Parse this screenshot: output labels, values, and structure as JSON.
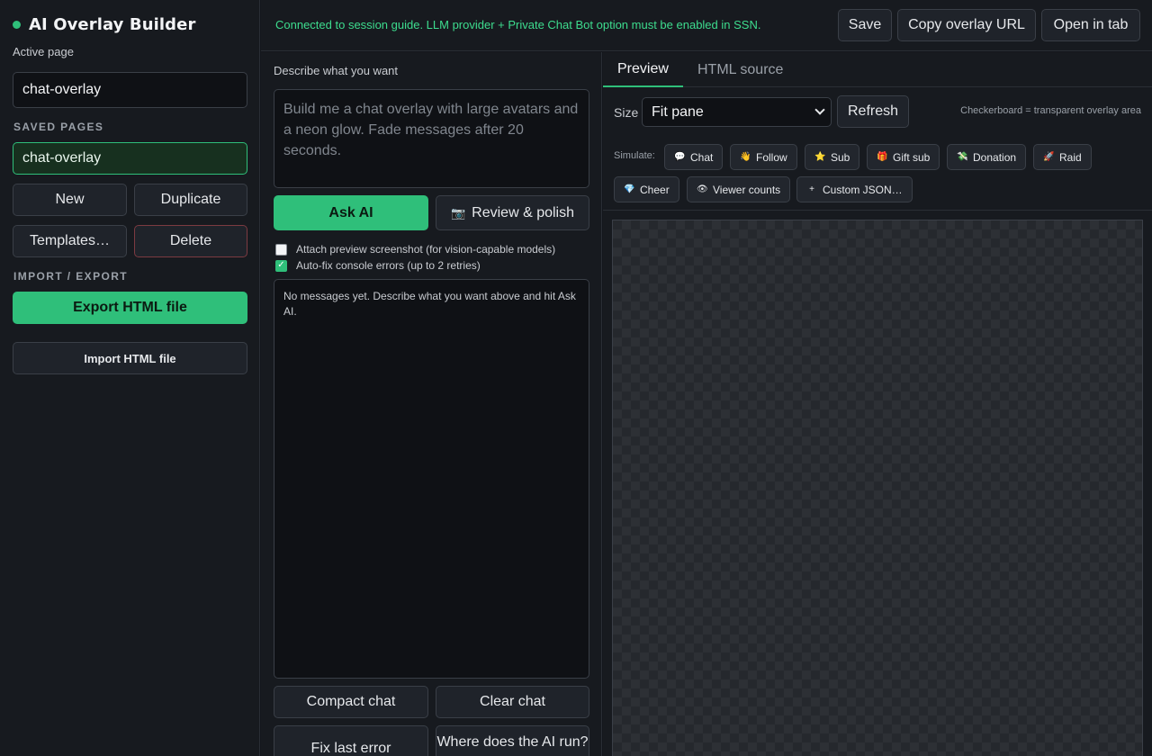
{
  "app": {
    "title": "AI Overlay Builder"
  },
  "sidebar": {
    "active_page_label": "Active page",
    "active_page_value": "chat-overlay",
    "saved_pages_label": "SAVED PAGES",
    "saved_pages": [
      "chat-overlay"
    ],
    "new_label": "New",
    "duplicate_label": "Duplicate",
    "templates_label": "Templates…",
    "delete_label": "Delete",
    "import_export_label": "IMPORT / EXPORT",
    "export_label": "Export HTML file",
    "import_label": "Import HTML file"
  },
  "topbar": {
    "status": "Connected to session guide. LLM provider + Private Chat Bot option must be enabled in SSN.",
    "save_label": "Save",
    "copy_url_label": "Copy overlay URL",
    "open_tab_label": "Open in tab"
  },
  "composer": {
    "heading": "Describe what you want",
    "placeholder": "Build me a chat overlay with large avatars and a neon glow. Fade messages after 20 seconds.",
    "ask_label": "Ask AI",
    "review_label": "Review & polish",
    "attach_screenshot_label": "Attach preview screenshot (for vision-capable models)",
    "attach_screenshot_checked": false,
    "autofix_label": "Auto-fix console errors (up to 2 retries)",
    "autofix_checked": true,
    "empty_log": "No messages yet. Describe what you want above and hit Ask AI.",
    "compact_label": "Compact chat",
    "clear_label": "Clear chat",
    "fix_error_label": "Fix last error",
    "where_label": "Where does the AI run?"
  },
  "preview": {
    "tabs": [
      "Preview",
      "HTML source"
    ],
    "active_tab": "Preview",
    "size_label": "Size",
    "size_value": "Fit pane",
    "refresh_label": "Refresh",
    "checker_note": "Checkerboard = transparent overlay area",
    "simulate_label": "Simulate:",
    "simulate": [
      {
        "label": "Chat",
        "icon": "speech-bubble-icon",
        "glyph": "💬"
      },
      {
        "label": "Follow",
        "icon": "wave-hand-icon",
        "glyph": "👋"
      },
      {
        "label": "Sub",
        "icon": "star-icon",
        "glyph": "⭐"
      },
      {
        "label": "Gift sub",
        "icon": "gift-icon",
        "glyph": "🎁"
      },
      {
        "label": "Donation",
        "icon": "money-icon",
        "glyph": "💸"
      },
      {
        "label": "Raid",
        "icon": "rocket-icon",
        "glyph": "🚀"
      },
      {
        "label": "Cheer",
        "icon": "gem-icon",
        "glyph": "💎"
      },
      {
        "label": "Viewer counts",
        "icon": "eye-icon",
        "glyph": "👁"
      },
      {
        "label": "Custom JSON…",
        "icon": "plus-icon",
        "glyph": "+"
      }
    ]
  },
  "colors": {
    "accent": "#2fbf7a",
    "background": "#171a1f",
    "status_text": "#3ddc8e",
    "danger_border": "#7c3a41"
  }
}
